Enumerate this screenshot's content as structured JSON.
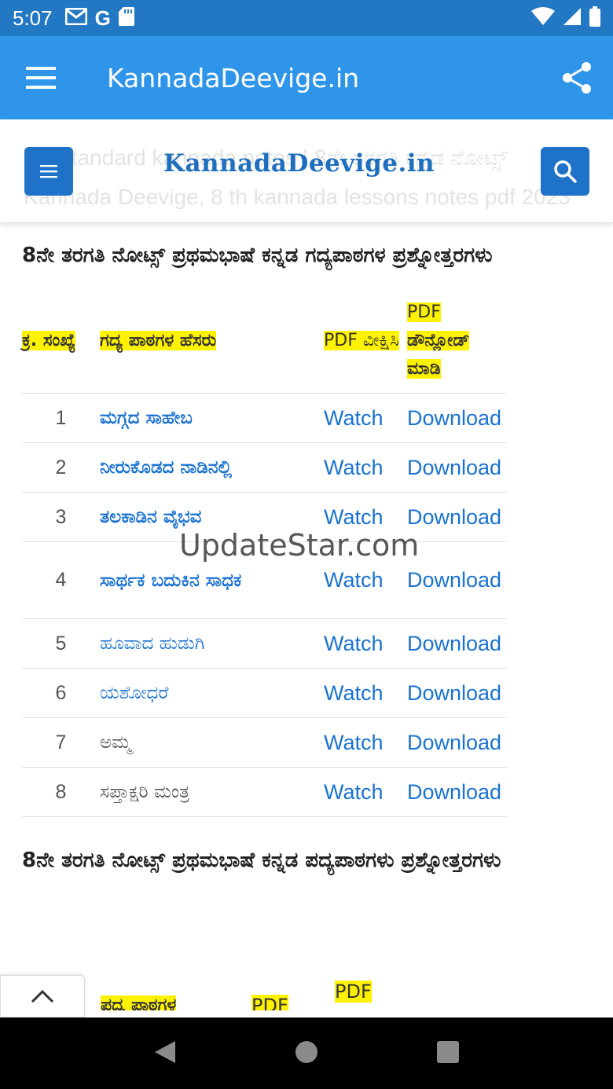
{
  "status_bar": {
    "time": "5:07",
    "icons": [
      "gmail-icon",
      "google-icon",
      "sd-card-icon",
      "wifi-icon",
      "signal-icon",
      "battery-icon"
    ]
  },
  "app_bar": {
    "title": "KannadaDeevige.in"
  },
  "web_header": {
    "logo": "KannadaDeevige.in",
    "ghost_line1": "8th standard kannada notes | 8ನೇ ತರಗತಿ ಕನ್ನಡ ನೋಟ್ಸ್",
    "ghost_line2": "Kannada Deevige, 8 th kannada lessons notes pdf 2023"
  },
  "section1": {
    "heading": "8ನೇ ತರಗತಿ ನೋಟ್ಸ್ ಪ್ರಥಮಭಾಷೆ ಕನ್ನಡ ಗದ್ಯಪಾಠಗಳ ಪ್ರಶ್ನೋತ್ತರಗಳು",
    "headers": {
      "sn": "ಕ್ರ. ಸಂಖ್ಯೆ",
      "name": "ಗದ್ಯ ಪಾಠಗಳ ಹೆಸರು",
      "view": "PDF ವೀಕ್ಷಿಸಿ",
      "download_1": "PDF",
      "download_2": "ಡೌನ್ಲೋಡ್ ಮಾಡಿ"
    },
    "rows": [
      {
        "n": "1",
        "name": "ಮಗ್ಗದ ಸಾಹೇಬ",
        "watch": "Watch",
        "download": "Download"
      },
      {
        "n": "2",
        "name": "ನೀರುಕೊಡದ ನಾಡಿನಲ್ಲಿ",
        "watch": "Watch",
        "download": "Download"
      },
      {
        "n": "3",
        "name": "ತಲಕಾಡಿನ ವೈಭವ",
        "watch": "Watch",
        "download": "Download"
      },
      {
        "n": "4",
        "name": "ಸಾರ್ಥಕ ಬದುಕಿನ ಸಾಧಕ",
        "watch": "Watch",
        "download": "Download"
      },
      {
        "n": "5",
        "name": "ಹೂವಾದ ಹುಡುಗಿ",
        "watch": "Watch",
        "download": "Download"
      },
      {
        "n": "6",
        "name": "ಯಶೋಧರೆ",
        "watch": "Watch",
        "download": "Download"
      },
      {
        "n": "7",
        "name": "ಅಮ್ಮ",
        "watch": "Watch",
        "download": "Download"
      },
      {
        "n": "8",
        "name": "ಸಪ್ತಾಕ್ಷರಿ ಮಂತ್ರ",
        "watch": "Watch",
        "download": "Download"
      }
    ]
  },
  "watermark": "UpdateStar.com",
  "section2": {
    "heading": "8ನೇ ತರಗತಿ ನೋಟ್ಸ್ ಪ್ರಥಮಭಾಷೆ ಕನ್ನಡ ಪದ್ಯಪಾಠಗಳು ಪ್ರಶ್ನೋತ್ತರಗಳು",
    "partial_headers": {
      "name": "ಪದ್ಯ ಪಾಠಗಳ",
      "view": "PDF",
      "download": "PDF"
    }
  }
}
